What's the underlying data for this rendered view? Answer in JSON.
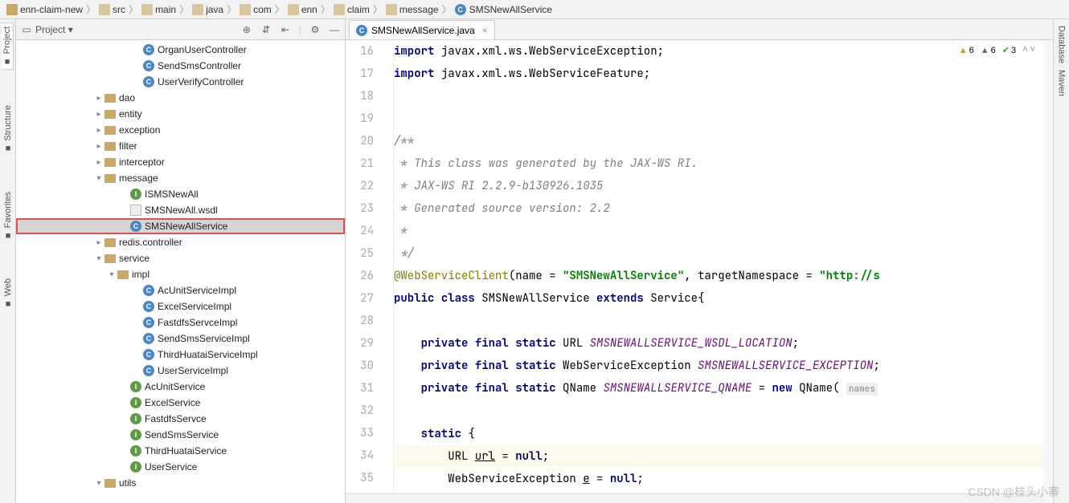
{
  "breadcrumb": [
    "enn-claim-new",
    "src",
    "main",
    "java",
    "com",
    "enn",
    "claim",
    "message",
    "SMSNewAllService"
  ],
  "projectHeader": {
    "label": "Project"
  },
  "tree": [
    {
      "indent": 9,
      "icon": "class-c",
      "label": "OrganUserController"
    },
    {
      "indent": 9,
      "icon": "class-c",
      "label": "SendSmsController"
    },
    {
      "indent": 9,
      "icon": "class-c",
      "label": "UserVerifyController"
    },
    {
      "indent": 6,
      "chev": "right",
      "icon": "folder",
      "label": "dao"
    },
    {
      "indent": 6,
      "chev": "right",
      "icon": "folder",
      "label": "entity"
    },
    {
      "indent": 6,
      "chev": "right",
      "icon": "folder",
      "label": "exception"
    },
    {
      "indent": 6,
      "chev": "right",
      "icon": "folder",
      "label": "filter"
    },
    {
      "indent": 6,
      "chev": "right",
      "icon": "folder",
      "label": "interceptor"
    },
    {
      "indent": 6,
      "chev": "down",
      "icon": "folder",
      "label": "message"
    },
    {
      "indent": 8,
      "icon": "class-i",
      "label": "ISMSNewAll"
    },
    {
      "indent": 8,
      "icon": "file-w",
      "label": "SMSNewAll.wsdl"
    },
    {
      "indent": 8,
      "icon": "class-c",
      "label": "SMSNewAllService",
      "selected": true,
      "highlighted": true
    },
    {
      "indent": 6,
      "chev": "right",
      "icon": "folder",
      "label": "redis.controller"
    },
    {
      "indent": 6,
      "chev": "down",
      "icon": "folder",
      "label": "service"
    },
    {
      "indent": 7,
      "chev": "down",
      "icon": "folder",
      "label": "impl"
    },
    {
      "indent": 9,
      "icon": "class-c",
      "label": "AcUnitServiceImpl"
    },
    {
      "indent": 9,
      "icon": "class-c",
      "label": "ExcelServiceImpl"
    },
    {
      "indent": 9,
      "icon": "class-c",
      "label": "FastdfsServceImpl"
    },
    {
      "indent": 9,
      "icon": "class-c",
      "label": "SendSmsServiceImpl"
    },
    {
      "indent": 9,
      "icon": "class-c",
      "label": "ThirdHuataiServiceImpl"
    },
    {
      "indent": 9,
      "icon": "class-c",
      "label": "UserServiceImpl"
    },
    {
      "indent": 8,
      "icon": "class-i",
      "label": "AcUnitService"
    },
    {
      "indent": 8,
      "icon": "class-i",
      "label": "ExcelService"
    },
    {
      "indent": 8,
      "icon": "class-i",
      "label": "FastdfsServce"
    },
    {
      "indent": 8,
      "icon": "class-i",
      "label": "SendSmsService"
    },
    {
      "indent": 8,
      "icon": "class-i",
      "label": "ThirdHuataiService"
    },
    {
      "indent": 8,
      "icon": "class-i",
      "label": "UserService"
    },
    {
      "indent": 6,
      "chev": "down",
      "icon": "folder",
      "label": "utils"
    }
  ],
  "tab": {
    "label": "SMSNewAllService.java"
  },
  "inspections": {
    "warn1": "6",
    "warn2": "6",
    "ok": "3"
  },
  "lineStart": 16,
  "lineEnd": 35,
  "code": [
    {
      "t": "<span class='kw'>import</span> javax.xml.ws.WebServiceException;"
    },
    {
      "t": "<span class='kw'>import</span> javax.xml.ws.WebServiceFeature;"
    },
    {
      "t": ""
    },
    {
      "t": ""
    },
    {
      "t": "<span class='com'>/**</span>"
    },
    {
      "t": "<span class='com'> * This class was generated by the JAX-WS RI.</span>"
    },
    {
      "t": "<span class='com'> * JAX-WS RI 2.2.9-b130926.1035</span>"
    },
    {
      "t": "<span class='com'> * Generated source version: 2.2</span>"
    },
    {
      "t": "<span class='com'> *</span>"
    },
    {
      "t": "<span class='com'> */</span>"
    },
    {
      "t": "<span class='ann'>@WebServiceClient</span>(name = <span class='str'>\"SMSNewAllService\"</span>, targetNamespace = <span class='str'>\"http://s</span>"
    },
    {
      "t": "<span class='kw'>public</span> <span class='kw'>class</span> SMSNewAllService <span class='kw'>extends</span> Service{"
    },
    {
      "t": ""
    },
    {
      "t": "    <span class='kw'>private</span> <span class='kw'>final</span> <span class='kw'>static</span> URL <span class='fld-it'>SMSNEWALLSERVICE_WSDL_LOCATION</span>;"
    },
    {
      "t": "    <span class='kw'>private</span> <span class='kw'>final</span> <span class='kw'>static</span> WebServiceException <span class='fld-it'>SMSNEWALLSERVICE_EXCEPTION</span>;"
    },
    {
      "t": "    <span class='kw'>private</span> <span class='kw'>final</span> <span class='kw'>static</span> QName <span class='fld-it'>SMSNEWALLSERVICE_QNAME</span> = <span class='kw'>new</span> QName( <span class='param-hint'>names</span>"
    },
    {
      "t": ""
    },
    {
      "t": "    <span class='kw'>static</span> {"
    },
    {
      "t": "        URL <u>url</u> = <span class='kw'>null</span>;",
      "hl": true
    },
    {
      "t": "        WebServiceException <u>e</u> = <span class='kw'>null</span>;"
    }
  ],
  "leftTabs": [
    "Project",
    "Structure",
    "Favorites",
    "Web"
  ],
  "rightTabs": [
    "Database",
    "Maven"
  ],
  "watermark": "CSDN @枝头小寨"
}
